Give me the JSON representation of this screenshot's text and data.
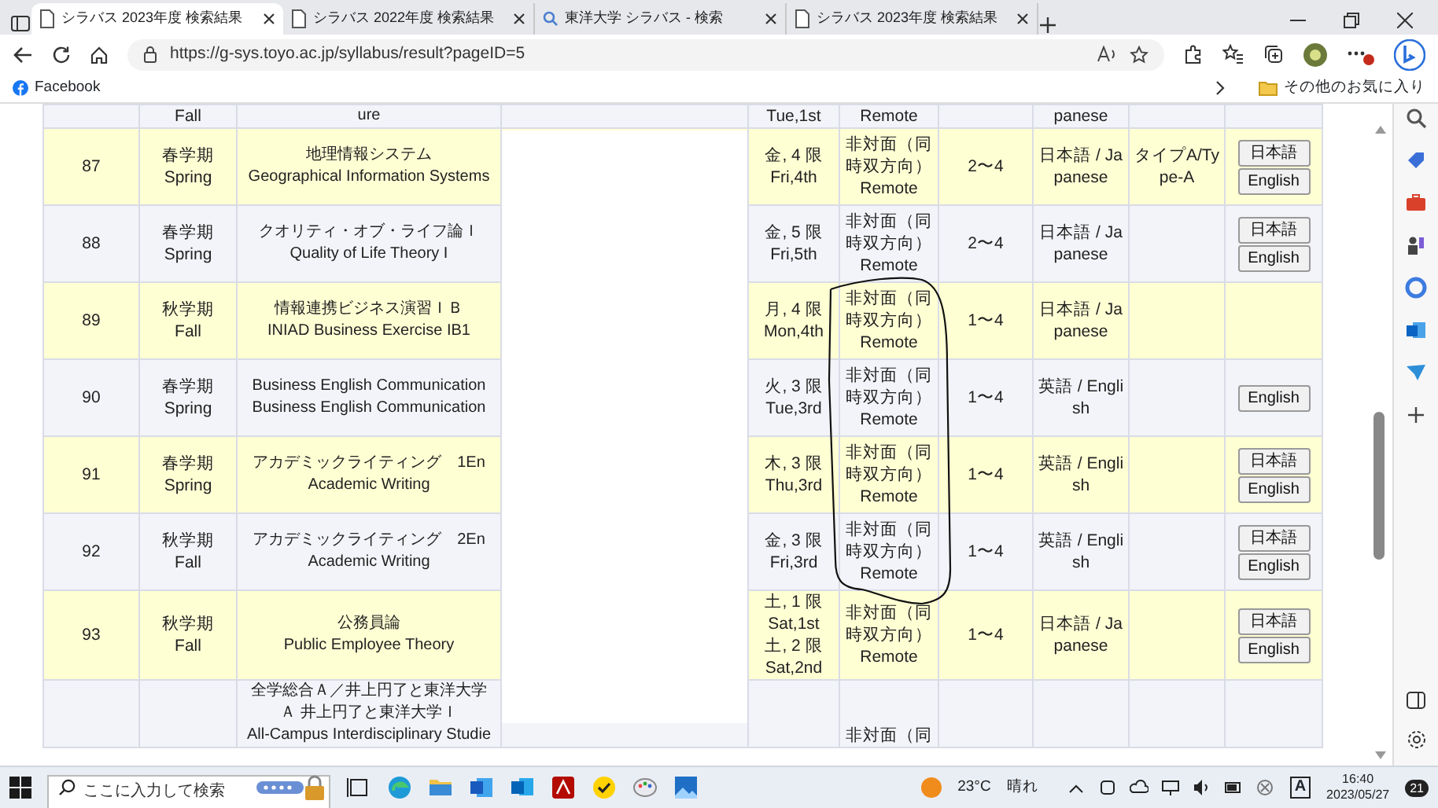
{
  "browser": {
    "tabs": [
      {
        "title": "シラバス 2023年度 検索結果",
        "selected": true,
        "kind": "page"
      },
      {
        "title": "シラバス 2022年度 検索結果",
        "selected": false,
        "kind": "page"
      },
      {
        "title": "東洋大学 シラバス - 検索",
        "selected": false,
        "kind": "search"
      },
      {
        "title": "シラバス 2023年度 検索結果",
        "selected": false,
        "kind": "page"
      }
    ],
    "url": "https://g-sys.toyo.ac.jp/syllabus/result?pageID=5",
    "bookmarks": [
      "Facebook"
    ],
    "other_favorites": "その他のお気に入り"
  },
  "table": {
    "rows": [
      {
        "term": [
          "Fall"
        ],
        "title": [
          "ure"
        ],
        "day": [
          "Tue,1st"
        ],
        "mode": [
          "Remote"
        ],
        "language": [
          "panese"
        ]
      },
      {
        "no": "87",
        "term": [
          "春学期",
          "Spring"
        ],
        "title": [
          "地理情報システム",
          "Geographical Information Systems"
        ],
        "day": [
          "金, 4 限",
          "Fri,4th"
        ],
        "mode": [
          "非対面（同",
          "時双方向）",
          "Remote"
        ],
        "credits": "2〜4",
        "language": [
          "日本語 / Ja",
          "panese"
        ],
        "type": [
          "タイプA/Ty",
          "pe-A"
        ],
        "buttons": [
          "日本語",
          "English"
        ]
      },
      {
        "no": "88",
        "term": [
          "春学期",
          "Spring"
        ],
        "title": [
          "クオリティ・オブ・ライフ論Ｉ",
          "Quality of Life Theory I"
        ],
        "day": [
          "金, 5 限",
          "Fri,5th"
        ],
        "mode": [
          "非対面（同",
          "時双方向）",
          "Remote"
        ],
        "credits": "2〜4",
        "language": [
          "日本語 / Ja",
          "panese"
        ],
        "buttons": [
          "日本語",
          "English"
        ]
      },
      {
        "no": "89",
        "term": [
          "秋学期",
          "Fall"
        ],
        "title": [
          "情報連携ビジネス演習ＩＢ",
          "INIAD Business Exercise IB1"
        ],
        "day": [
          "月, 4 限",
          "Mon,4th"
        ],
        "mode": [
          "非対面（同",
          "時双方向）",
          "Remote"
        ],
        "credits": "1〜4",
        "language": [
          "日本語 / Ja",
          "panese"
        ]
      },
      {
        "no": "90",
        "term": [
          "春学期",
          "Spring"
        ],
        "title": [
          "Business English Communication",
          "Business English Communication"
        ],
        "day": [
          "火, 3 限",
          "Tue,3rd"
        ],
        "mode": [
          "非対面（同",
          "時双方向）",
          "Remote"
        ],
        "credits": "1〜4",
        "language": [
          "英語 / Engli",
          "sh"
        ],
        "buttons": [
          "English"
        ]
      },
      {
        "no": "91",
        "term": [
          "春学期",
          "Spring"
        ],
        "title": [
          "アカデミックライティング　1En",
          "Academic Writing"
        ],
        "day": [
          "木, 3 限",
          "Thu,3rd"
        ],
        "mode": [
          "非対面（同",
          "時双方向）",
          "Remote"
        ],
        "credits": "1〜4",
        "language": [
          "英語 / Engli",
          "sh"
        ],
        "buttons": [
          "日本語",
          "English"
        ]
      },
      {
        "no": "92",
        "term": [
          "秋学期",
          "Fall"
        ],
        "title": [
          "アカデミックライティング　2En",
          "Academic Writing"
        ],
        "day": [
          "金, 3 限",
          "Fri,3rd"
        ],
        "mode": [
          "非対面（同",
          "時双方向）",
          "Remote"
        ],
        "credits": "1〜4",
        "language": [
          "英語 / Engli",
          "sh"
        ],
        "buttons": [
          "日本語",
          "English"
        ]
      },
      {
        "no": "93",
        "term": [
          "秋学期",
          "Fall"
        ],
        "title": [
          "公務員論",
          "Public Employee Theory"
        ],
        "day": [
          "土, 1 限",
          "Sat,1st",
          "土, 2 限",
          "Sat,2nd"
        ],
        "mode": [
          "非対面（同",
          "時双方向）",
          "Remote"
        ],
        "credits": "1〜4",
        "language": [
          "日本語 / Ja",
          "panese"
        ],
        "buttons": [
          "日本語",
          "English"
        ]
      },
      {
        "title": [
          "全学総合Ａ／井上円了と東洋大学",
          "Ａ 井上円了と東洋大学Ｉ",
          "All-Campus Interdisciplinary Studie"
        ],
        "mode": [
          "非対面（同"
        ]
      }
    ]
  },
  "taskbar": {
    "search_placeholder": "ここに入力して検索",
    "temperature": "23°C",
    "weather": "晴れ",
    "ime_mode": "A",
    "time": "16:40",
    "date": "2023/05/27",
    "notifications": "21"
  }
}
